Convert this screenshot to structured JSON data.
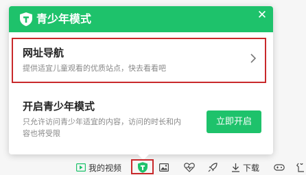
{
  "popup": {
    "title": "青少年模式",
    "close_glyph": "✕",
    "nav": {
      "title": "网址导航",
      "description": "提供适宜儿童观看的优质站点，快去看看吧"
    },
    "mode": {
      "title": "开启青少年模式",
      "description": "只允许访问青少年适宜的内容，访问的时长和内容也将受限",
      "enable_label": "立即开启"
    }
  },
  "toolbar": {
    "video_label": "我的视频",
    "download_label": "下载"
  },
  "colors": {
    "brand_green": "#1ec26b",
    "highlight_red": "#c8282a"
  },
  "icons": {
    "header": "shield-icon",
    "chevron": "chevron-right-icon",
    "video": "play-icon",
    "teen_mode": "shield-icon",
    "image": "image-icon",
    "health": "heartbeat-icon",
    "rocket": "rocket-icon",
    "download": "download-icon",
    "game": "gamepad-icon",
    "skin": "skin-icon"
  }
}
